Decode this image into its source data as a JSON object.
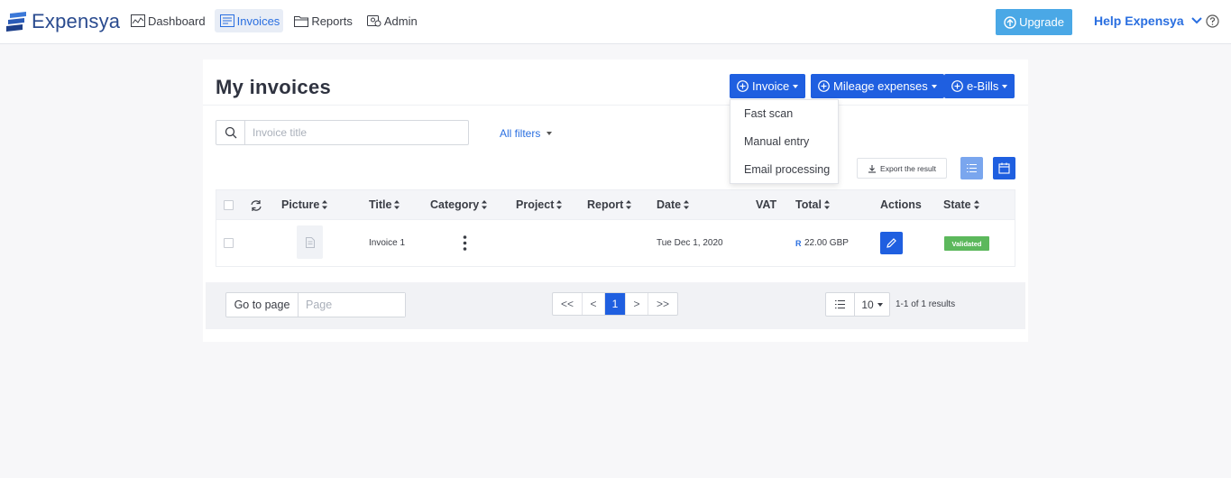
{
  "app": {
    "name": "Expensya"
  },
  "nav": {
    "items": [
      {
        "label": "Dashboard",
        "icon": "chart-icon",
        "active": false
      },
      {
        "label": "Invoices",
        "icon": "invoice-icon",
        "active": true
      },
      {
        "label": "Reports",
        "icon": "folder-icon",
        "active": false
      },
      {
        "label": "Admin",
        "icon": "admin-icon",
        "active": false
      }
    ],
    "upgrade_label": "Upgrade",
    "help_label": "Help Expensya"
  },
  "page": {
    "title": "My invoices",
    "actions": {
      "invoice_label": "Invoice",
      "mileage_label": "Mileage expenses",
      "ebills_label": "e-Bills"
    },
    "invoice_menu": [
      "Fast scan",
      "Manual entry",
      "Email processing"
    ],
    "search": {
      "placeholder": "Invoice title"
    },
    "filters_label": "All filters",
    "export_label": "Export the result"
  },
  "table": {
    "columns": [
      "Picture",
      "Title",
      "Category",
      "Project",
      "Report",
      "Date",
      "VAT",
      "Total",
      "Actions",
      "State"
    ],
    "rows": [
      {
        "title": "Invoice 1",
        "category": "",
        "project": "",
        "report": "",
        "date": "Tue Dec 1, 2020",
        "vat": "",
        "total_symbol": "R",
        "total": "22.00 GBP",
        "state": "Validated"
      }
    ]
  },
  "pagination": {
    "goto_label": "Go to page",
    "page_placeholder": "Page",
    "buttons": [
      "<<",
      "<",
      "1",
      ">",
      ">>"
    ],
    "current": "1",
    "page_size": "10",
    "results": "1-1 of 1 results"
  },
  "colors": {
    "primary": "#1f5fe0",
    "upgrade": "#4aa8e6",
    "validated": "#5cb85c",
    "brand": "#2a4b8f"
  }
}
